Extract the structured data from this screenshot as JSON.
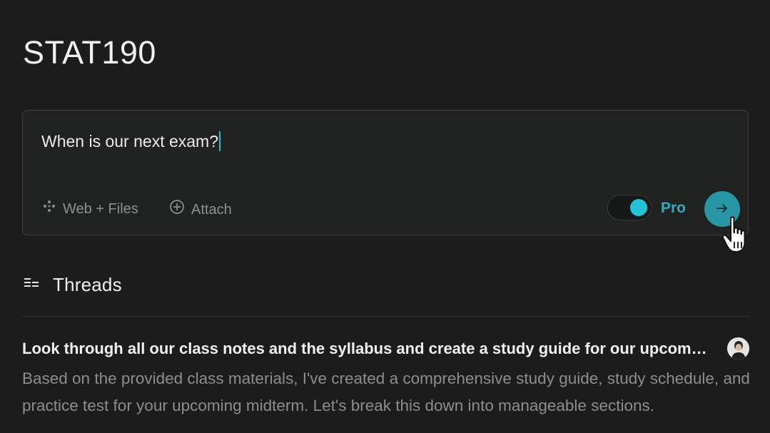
{
  "space": {
    "title": "STAT190"
  },
  "composer": {
    "query": "When is our next exam?",
    "tools": {
      "sources_label": "Web + Files",
      "attach_label": "Attach"
    },
    "pro": {
      "label": "Pro",
      "enabled": true
    }
  },
  "threads": {
    "header": "Threads",
    "items": [
      {
        "title": "Look through all our class notes and the syllabus and create a study guide for our upcoming midterm",
        "preview": "Based on the provided class materials, I've created a comprehensive study guide, study schedule, and practice test for your upcoming midterm. Let's break this down into manageable sections."
      }
    ]
  },
  "colors": {
    "background": "#1c1c1c",
    "accent": "#22c3d6",
    "submit": "#2796a5"
  }
}
